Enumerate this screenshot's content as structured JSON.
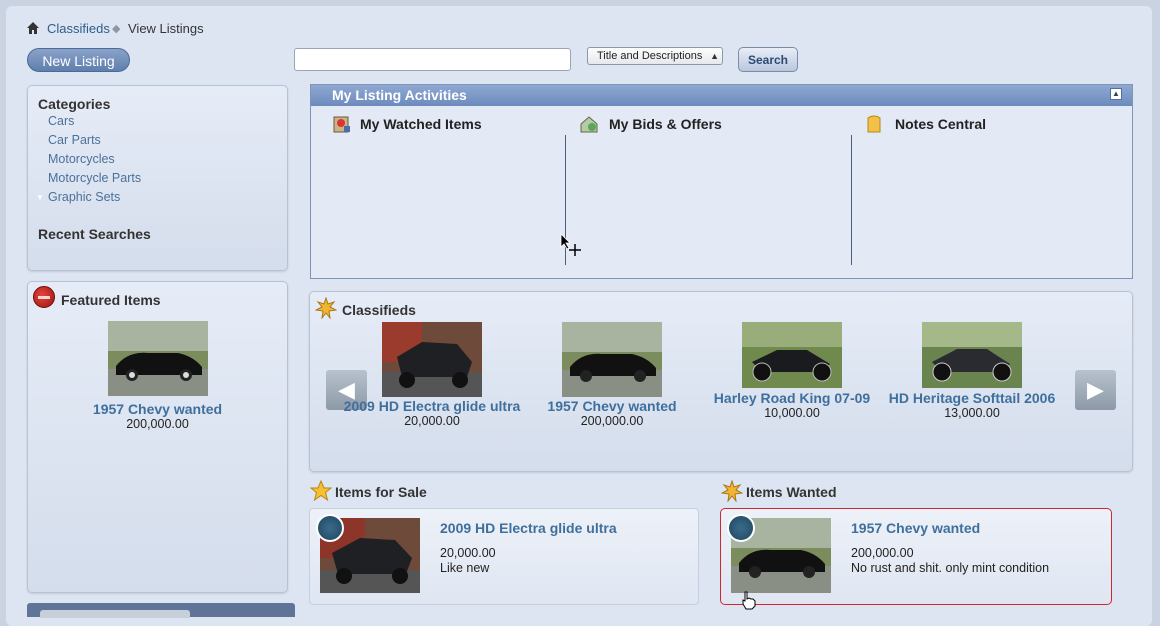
{
  "breadcrumb": {
    "home": "Classifieds",
    "current": "View Listings"
  },
  "toolbar": {
    "new_listing": "New Listing",
    "search_value": "",
    "scope_selected": "Title and Descriptions",
    "search_label": "Search"
  },
  "sidebar": {
    "categories_title": "Categories",
    "categories": [
      "Cars",
      "Car Parts",
      "Motorcycles",
      "Motorcycle Parts",
      "Graphic Sets"
    ],
    "recent_title": "Recent Searches",
    "featured_title": "Featured Items",
    "featured_item": {
      "title": "1957 Chevy wanted",
      "price": "200,000.00"
    }
  },
  "activities": {
    "title": "My Listing Activities",
    "columns": [
      "My Watched Items",
      "My Bids & Offers",
      "Notes Central"
    ]
  },
  "classifieds": {
    "title": "Classifieds",
    "items": [
      {
        "title": "2009 HD Electra glide ultra",
        "price": "20,000.00"
      },
      {
        "title": "1957 Chevy wanted",
        "price": "200,000.00"
      },
      {
        "title": "Harley Road King 07-09",
        "price": "10,000.00"
      },
      {
        "title": "HD Heritage Softtail 2006",
        "price": "13,000.00"
      }
    ]
  },
  "items_for_sale": {
    "title": "Items for Sale",
    "item": {
      "title": "2009 HD Electra glide ultra",
      "price": "20,000.00",
      "desc": "Like new"
    }
  },
  "items_wanted": {
    "title": "Items Wanted",
    "item": {
      "title": "1957 Chevy wanted",
      "price": "200,000.00",
      "desc": "No rust and shit. only mint condition"
    }
  },
  "colors": {
    "accent": "#6c8bbd",
    "link": "#3f6f9c",
    "highlight_border": "#d2262e"
  }
}
